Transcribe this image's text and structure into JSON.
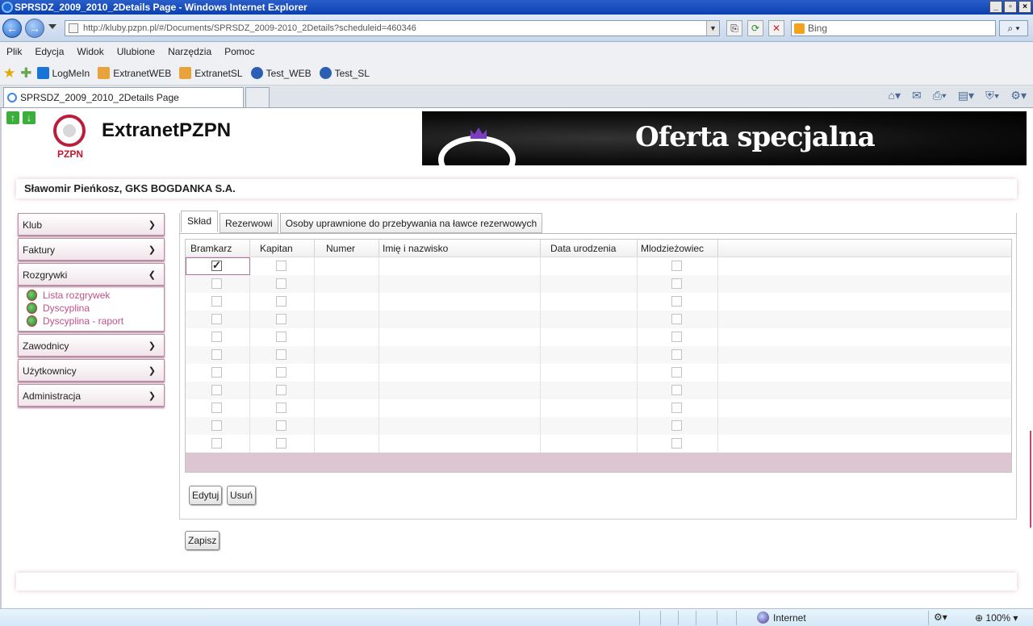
{
  "window": {
    "title": "SPRSDZ_2009_2010_2Details Page - Windows Internet Explorer"
  },
  "address": {
    "url": "http://kluby.pzpn.pl/#/Documents/SPRSDZ_2009-2010_2Details?scheduleid=460346",
    "search_placeholder": "Bing"
  },
  "menu": [
    "Plik",
    "Edycja",
    "Widok",
    "Ulubione",
    "Narzędzia",
    "Pomoc"
  ],
  "favorites": [
    {
      "label": "LogMeIn",
      "color": "#1a73d9"
    },
    {
      "label": "ExtranetWEB",
      "color": "#e8a33a"
    },
    {
      "label": "ExtranetSL",
      "color": "#e8a33a"
    },
    {
      "label": "Test_WEB",
      "color": "#2b5fb3"
    },
    {
      "label": "Test_SL",
      "color": "#2b5fb3"
    }
  ],
  "browser_tab": {
    "title": "SPRSDZ_2009_2010_2Details Page"
  },
  "app": {
    "title": "ExtranetPZPN",
    "logo_text": "PZPN",
    "banner_text": "Oferta specjalna"
  },
  "user": {
    "line": "Sławomir Pieńkosz, GKS BOGDANKA S.A."
  },
  "sidebar": {
    "items": [
      {
        "label": "Klub",
        "expanded": false
      },
      {
        "label": "Faktury",
        "expanded": false
      },
      {
        "label": "Rozgrywki",
        "expanded": true
      },
      {
        "label": "Zawodnicy",
        "expanded": false
      },
      {
        "label": "Użytkownicy",
        "expanded": false
      },
      {
        "label": "Administracja",
        "expanded": false
      }
    ],
    "rozgrywki_sub": [
      "Lista rozgrywek",
      "Dyscyplina",
      "Dyscyplina - raport"
    ]
  },
  "tabs": [
    "Skład",
    "Rezerwowi",
    "Osoby uprawnione do przebywania na ławce rezerwowych"
  ],
  "grid": {
    "columns": [
      "Bramkarz",
      "Kapitan",
      "Numer",
      "Imię i nazwisko",
      "Data urodzenia",
      "Mlodzieżowiec"
    ],
    "row_count": 11,
    "checked_bramkarz_row": 0
  },
  "buttons": {
    "edit": "Edytuj",
    "delete": "Usuń",
    "save": "Zapisz"
  },
  "status": {
    "zone": "Internet",
    "zoom": "100%"
  },
  "colors": {
    "accent": "#c0508a",
    "grid_footer": "#dec5d2",
    "border": "#b98ca3"
  }
}
